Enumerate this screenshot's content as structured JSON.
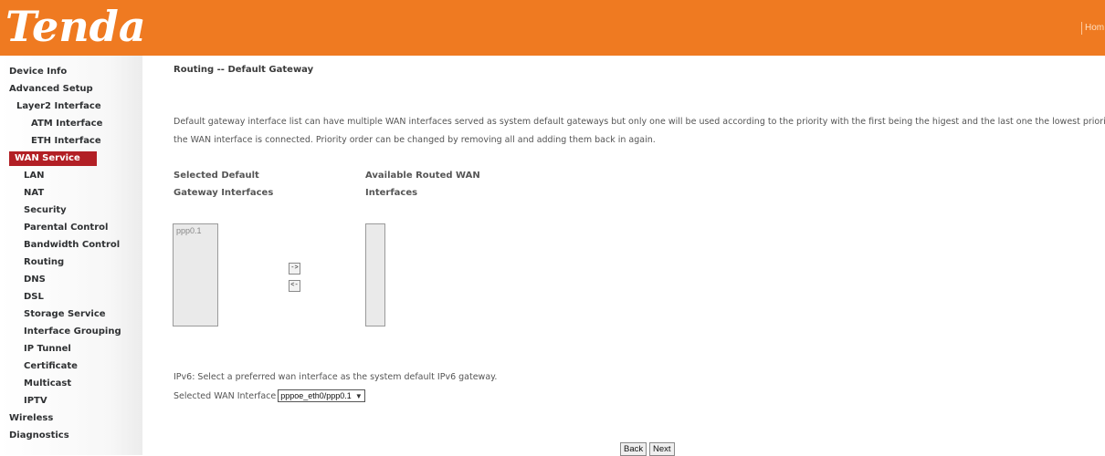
{
  "header": {
    "logo_text": "Tenda",
    "home_link": "Hom",
    "brand_color": "#ef7a21"
  },
  "sidebar": {
    "items": [
      {
        "label": "Device Info",
        "level": 0
      },
      {
        "label": "Advanced Setup",
        "level": 0
      },
      {
        "label": "Layer2 Interface",
        "level": 1
      },
      {
        "label": "ATM Interface",
        "level": 2
      },
      {
        "label": "ETH Interface",
        "level": 2
      },
      {
        "label": "WAN Service",
        "level": 1,
        "active": true
      },
      {
        "label": "LAN",
        "level": 1
      },
      {
        "label": "NAT",
        "level": 1
      },
      {
        "label": "Security",
        "level": 1
      },
      {
        "label": "Parental Control",
        "level": 1
      },
      {
        "label": "Bandwidth Control",
        "level": 1
      },
      {
        "label": "Routing",
        "level": 1
      },
      {
        "label": "DNS",
        "level": 1
      },
      {
        "label": "DSL",
        "level": 1
      },
      {
        "label": "Storage Service",
        "level": 1
      },
      {
        "label": "Interface Grouping",
        "level": 1
      },
      {
        "label": "IP Tunnel",
        "level": 1
      },
      {
        "label": "Certificate",
        "level": 1
      },
      {
        "label": "Multicast",
        "level": 1
      },
      {
        "label": "IPTV",
        "level": 1
      },
      {
        "label": "Wireless",
        "level": 0
      },
      {
        "label": "Diagnostics",
        "level": 0
      }
    ],
    "active_color": "#b21f25"
  },
  "main": {
    "title": "Routing -- Default Gateway",
    "description_line1": "Default gateway interface list can have multiple WAN interfaces served as system default gateways but only one will be used according to the priority with the first being the higest and the last one the lowest priority if",
    "description_line2": "the WAN interface is connected. Priority order can be changed by removing all and adding them back in again.",
    "selected_label_line1": "Selected Default",
    "selected_label_line2": "Gateway Interfaces",
    "available_label_line1": "Available Routed WAN",
    "available_label_line2": "Interfaces",
    "selected_interfaces": [
      "ppp0.1"
    ],
    "available_interfaces": [],
    "move_right_label": "->",
    "move_left_label": "<-",
    "ipv6_note": "IPv6: Select a preferred wan interface as the system default IPv6 gateway.",
    "wan_interface_label": "Selected WAN Interface",
    "wan_interface_value": "pppoe_eth0/ppp0.1",
    "back_label": "Back",
    "next_label": "Next"
  }
}
